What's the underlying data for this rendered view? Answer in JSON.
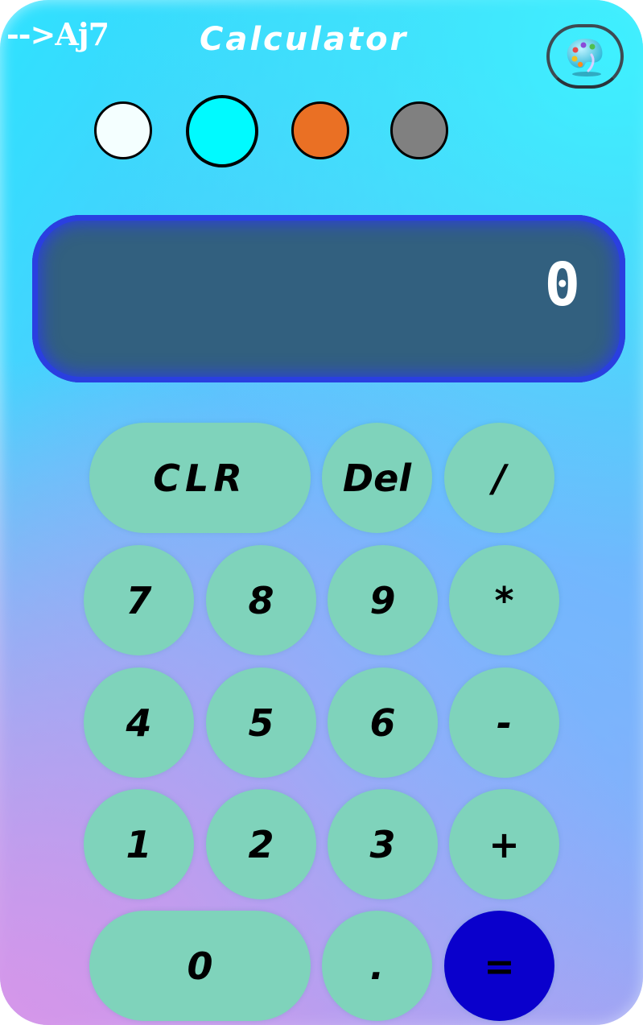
{
  "header": {
    "brand": "-->Aj7",
    "title": "Calculator",
    "theme_button_icon": "palette-icon"
  },
  "themes": [
    {
      "name": "white",
      "color": "#f4ffff"
    },
    {
      "name": "cyan",
      "color": "#00faff",
      "selected": true
    },
    {
      "name": "orange",
      "color": "#ea7024"
    },
    {
      "name": "gray",
      "color": "#808080"
    }
  ],
  "display": {
    "value": "0"
  },
  "keys": {
    "clear": "CLR",
    "delete": "Del",
    "divide": "/",
    "seven": "7",
    "eight": "8",
    "nine": "9",
    "multiply": "*",
    "four": "4",
    "five": "5",
    "six": "6",
    "subtract": "-",
    "one": "1",
    "two": "2",
    "three": "3",
    "add": "+",
    "zero": "0",
    "decimal": ".",
    "equals": "="
  },
  "colors": {
    "key_background": "#7fd3bb",
    "equals_background": "#0a00cc",
    "display_background": "#32607f",
    "display_border": "#2a3fe0"
  }
}
